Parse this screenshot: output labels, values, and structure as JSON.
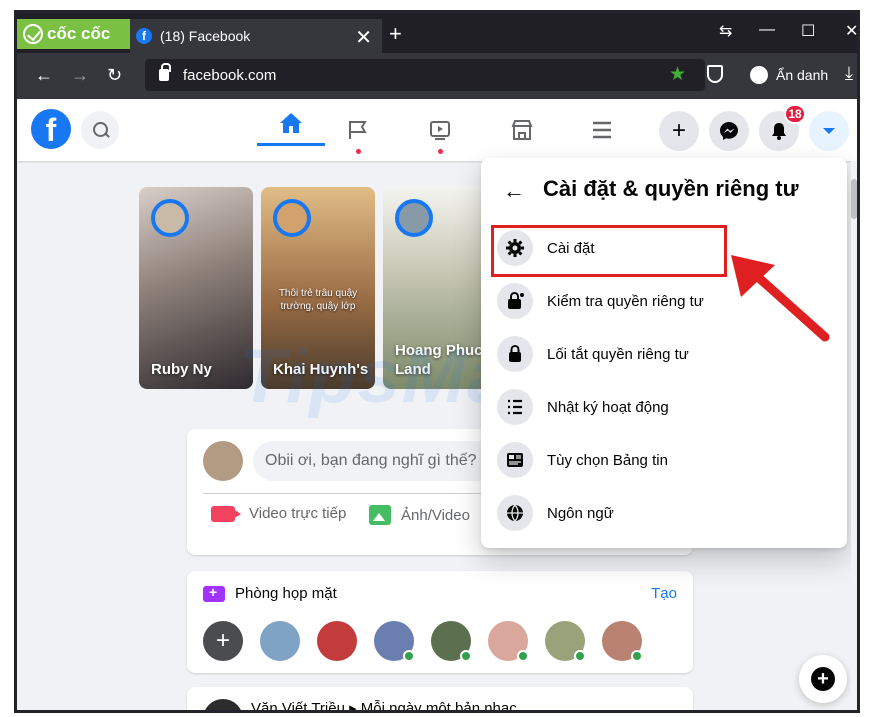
{
  "browser": {
    "brand": "cốc cốc",
    "tab_title": "(18) Facebook",
    "tab_favicon": "f",
    "tab_close": "✕",
    "new_tab": "+",
    "url": "facebook.com",
    "incognito_label": "Ẩn danh",
    "window_controls": {
      "restore_tabs": "⇆",
      "minimize": "—",
      "maximize": "☐",
      "close": "✕"
    },
    "nav": {
      "back": "←",
      "forward": "→",
      "reload": "↻"
    },
    "star": "★",
    "download": "⤓"
  },
  "header": {
    "logo": "f",
    "notification_count": "18",
    "plus": "+"
  },
  "stories": [
    {
      "name": "Ruby Ny",
      "caption": ""
    },
    {
      "name": "Khai Huynh's",
      "caption": "Thôi trẻ trâu quậy trường, quậy lớp"
    },
    {
      "name": "Hoang Phuc Land",
      "caption": ""
    }
  ],
  "composer": {
    "placeholder": "Obii ơi, bạn đang nghĩ gì thế?",
    "live_video": "Video trực tiếp",
    "photo_video": "Ảnh/Video"
  },
  "rooms": {
    "title": "Phòng họp mặt",
    "create": "Tạo",
    "plus": "+"
  },
  "post": {
    "header": "Văn Viết Triều ▸ Mỗi ngày một bản nhạc"
  },
  "settings_menu": {
    "back": "←",
    "title": "Cài đặt & quyền riêng tư",
    "items": [
      {
        "label": "Cài đặt",
        "icon": "gear-icon"
      },
      {
        "label": "Kiểm tra quyền riêng tư",
        "icon": "lock-check-icon"
      },
      {
        "label": "Lối tắt quyền riêng tư",
        "icon": "lock-icon"
      },
      {
        "label": "Nhật ký hoạt động",
        "icon": "list-icon"
      },
      {
        "label": "Tùy chọn Bảng tin",
        "icon": "feed-icon"
      },
      {
        "label": "Ngôn ngữ",
        "icon": "globe-icon"
      }
    ]
  },
  "fab": "+",
  "watermark": "TipsMake",
  "colors": {
    "facebook_blue": "#1877f2",
    "annotation_red": "#e02020",
    "browser_dark": "#36363d",
    "coccoc_green": "#7ac043"
  }
}
